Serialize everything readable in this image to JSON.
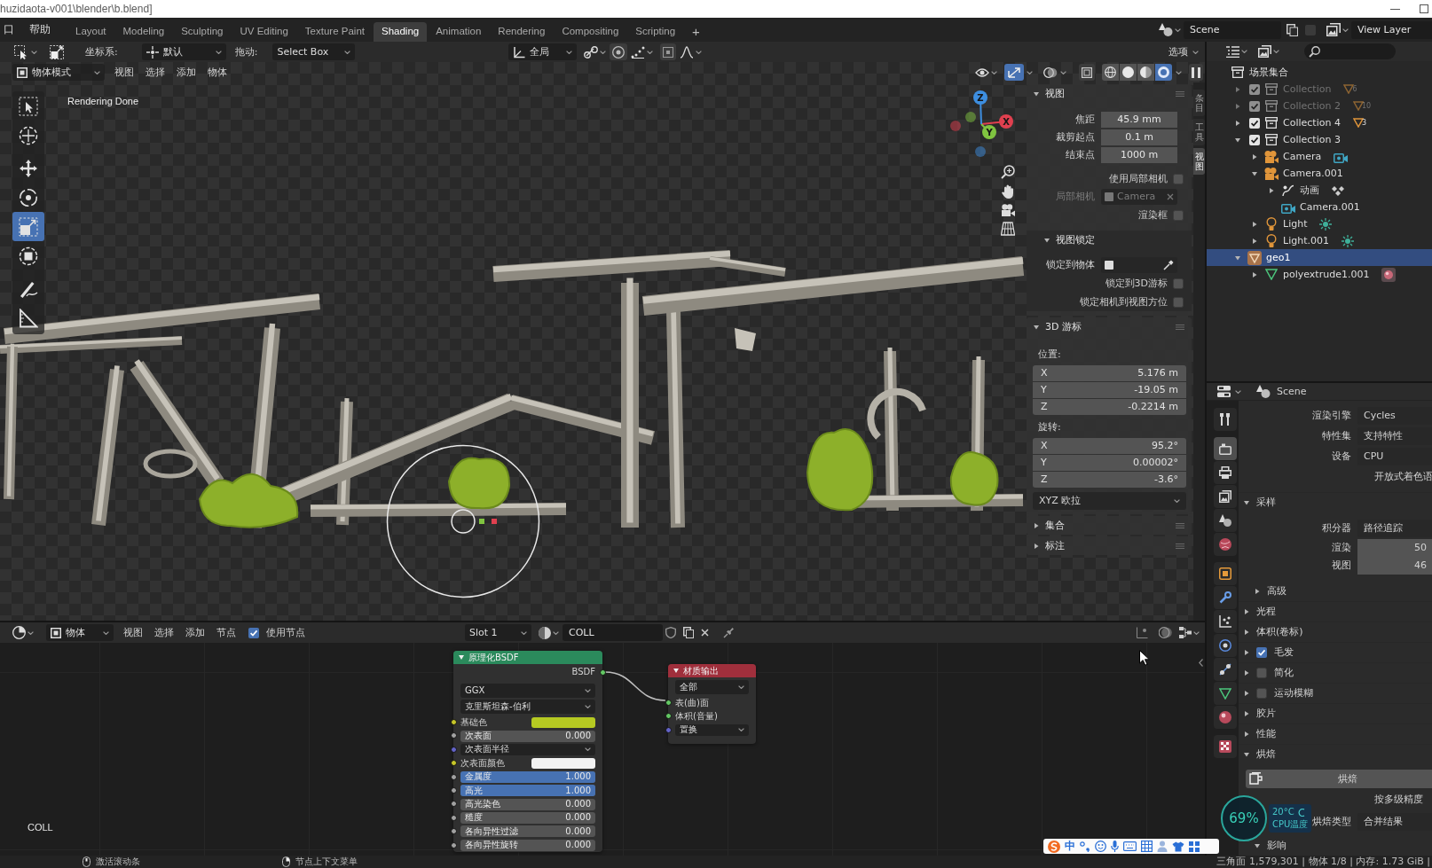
{
  "title_bar": {
    "title": "huzidaota-v001\\blender\\b.blend]"
  },
  "top_bar": {
    "menus": [
      "口",
      "帮助"
    ],
    "workspaces": [
      {
        "label": "Layout",
        "selected": false
      },
      {
        "label": "Modeling",
        "selected": false
      },
      {
        "label": "Sculpting",
        "selected": false
      },
      {
        "label": "UV Editing",
        "selected": false
      },
      {
        "label": "Texture Paint",
        "selected": false
      },
      {
        "label": "Shading",
        "selected": true
      },
      {
        "label": "Animation",
        "selected": false
      },
      {
        "label": "Rendering",
        "selected": false
      },
      {
        "label": "Compositing",
        "selected": false
      },
      {
        "label": "Scripting",
        "selected": false
      }
    ],
    "add_workspace": "+",
    "scene": "Scene",
    "view_layer": "View Layer"
  },
  "viewport": {
    "tool_settings": {
      "orientation_label": "坐标系:",
      "orientation": "默认",
      "drag_label": "拖动:",
      "drag": "Select Box",
      "transform_orientation": "全局",
      "options": "选项"
    },
    "header": {
      "mode": "物体模式",
      "menus": [
        "视图",
        "选择",
        "添加",
        "物体"
      ],
      "gizmos": true,
      "shading": [
        {
          "kind": "wireframe",
          "selected": false
        },
        {
          "kind": "solid",
          "selected": false
        },
        {
          "kind": "material",
          "selected": false
        },
        {
          "kind": "rendered",
          "selected": true
        }
      ]
    },
    "status": "Rendering Done",
    "tools": [
      {
        "kind": "select_box",
        "selected": false
      },
      {
        "kind": "cursor",
        "selected": false
      },
      {
        "kind": "move",
        "selected": false
      },
      {
        "kind": "rotate",
        "selected": false
      },
      {
        "kind": "scale",
        "selected": true
      },
      {
        "kind": "transform",
        "selected": false
      },
      {
        "kind": "annotate",
        "selected": false
      },
      {
        "kind": "measure",
        "selected": false
      }
    ],
    "gizmo_axes": [
      {
        "label": "X",
        "color": "#e0404f"
      },
      {
        "label": "Y",
        "color": "#80c440"
      },
      {
        "label": "Z",
        "color": "#3d8ee0"
      }
    ],
    "sidebar": {
      "panels": [
        {
          "title": "视图",
          "expanded": true,
          "rows": [
            {
              "kind": "number",
              "label": "焦距",
              "value": "45.9 mm"
            },
            {
              "kind": "number",
              "label": "裁剪起点",
              "value": "0.1 m"
            },
            {
              "kind": "number",
              "label": "结束点",
              "value": "1000 m"
            },
            {
              "kind": "checkbox",
              "label": "使用局部相机",
              "checked": false
            },
            {
              "kind": "object",
              "label": "局部相机",
              "value": "Camera",
              "disabled": true
            },
            {
              "kind": "checkbox",
              "label": "渲染框",
              "checked": false
            },
            {
              "kind": "subpanel",
              "title": "视图锁定",
              "expanded": true,
              "rows": [
                {
                  "kind": "picker",
                  "label": "锁定到物体"
                },
                {
                  "kind": "checkbox",
                  "label": "锁定到3D游标",
                  "checked": false
                },
                {
                  "kind": "checkbox",
                  "label": "锁定相机到视图方位",
                  "checked": false
                }
              ]
            }
          ]
        },
        {
          "title": "3D 游标",
          "expanded": true,
          "rows": [
            {
              "kind": "caption",
              "label": "位置:"
            },
            {
              "kind": "vector",
              "items": [
                {
                  "axis": "X",
                  "value": "5.176 m"
                },
                {
                  "axis": "Y",
                  "value": "-19.05 m"
                },
                {
                  "axis": "Z",
                  "value": "-0.2214 m"
                }
              ]
            },
            {
              "kind": "caption",
              "label": "旋转:"
            },
            {
              "kind": "vector",
              "items": [
                {
                  "axis": "X",
                  "value": "95.2°"
                },
                {
                  "axis": "Y",
                  "value": "0.00002°"
                },
                {
                  "axis": "Z",
                  "value": "-3.6°"
                }
              ]
            },
            {
              "kind": "dropdown",
              "value": "XYZ 欧拉"
            }
          ]
        },
        {
          "title": "集合",
          "expanded": false
        },
        {
          "title": "标注",
          "expanded": false
        }
      ]
    },
    "sidebar_tabs": [
      {
        "label": "条目",
        "selected": false
      },
      {
        "label": "工具",
        "selected": false
      },
      {
        "label": "视图",
        "selected": true
      }
    ]
  },
  "node_editor": {
    "header": {
      "object": "物体",
      "menus": [
        "视图",
        "选择",
        "添加",
        "节点"
      ],
      "use_nodes": {
        "label": "使用节点",
        "checked": true
      },
      "slot": "Slot 1",
      "material": "COLL"
    },
    "material_label": "COLL",
    "nodes": [
      {
        "kind": "principled",
        "title": "原理化BSDF",
        "output": "BSDF",
        "dropdowns": [
          "GGX",
          "克里斯坦森-伯利"
        ],
        "inputs": [
          {
            "kind": "color",
            "label": "基础色",
            "color": "#b6ca22"
          },
          {
            "kind": "value",
            "label": "次表面",
            "value": "0.000",
            "level": 0
          },
          {
            "kind": "vector",
            "label": "次表面半径"
          },
          {
            "kind": "color",
            "label": "次表面颜色",
            "color": "#f2f2f2"
          },
          {
            "kind": "value",
            "label": "金属度",
            "value": "1.000",
            "level": 1
          },
          {
            "kind": "value",
            "label": "高光",
            "value": "1.000",
            "level": 1
          },
          {
            "kind": "value",
            "label": "高光染色",
            "value": "0.000",
            "level": 0
          },
          {
            "kind": "value",
            "label": "糙度",
            "value": "0.000",
            "level": 0
          },
          {
            "kind": "value",
            "label": "各向异性过滤",
            "value": "0.000",
            "level": 0
          },
          {
            "kind": "value",
            "label": "各向异性旋转",
            "value": "0.000",
            "level": 0
          }
        ]
      },
      {
        "kind": "output",
        "title": "材质输出",
        "target": "全部",
        "inputs": [
          {
            "kind": "shader",
            "label": "表(曲)面"
          },
          {
            "kind": "shader",
            "label": "体积(音量)"
          },
          {
            "kind": "vector",
            "label": "置换"
          }
        ]
      }
    ]
  },
  "outliner": {
    "root": {
      "label": "场景集合",
      "selected": false,
      "children": [
        {
          "kind": "collection",
          "label": "Collection",
          "checked": true,
          "dimmed": true,
          "expanded": false,
          "selected": false,
          "count": "6"
        },
        {
          "kind": "collection",
          "label": "Collection 2",
          "checked": true,
          "dimmed": true,
          "expanded": false,
          "selected": false,
          "count": "10"
        },
        {
          "kind": "collection",
          "label": "Collection 4",
          "checked": true,
          "dimmed": false,
          "expanded": false,
          "selected": false,
          "count": "3"
        },
        {
          "kind": "collection",
          "label": "Collection 3",
          "checked": true,
          "dimmed": false,
          "expanded": true,
          "selected": false,
          "children": [
            {
              "kind": "camera",
              "label": "Camera",
              "expanded": false,
              "selected": false
            },
            {
              "kind": "camera",
              "label": "Camera.001",
              "expanded": true,
              "selected": false,
              "children": [
                {
                  "kind": "animation",
                  "label": "动画",
                  "expanded": false,
                  "selected": false
                },
                {
                  "kind": "camera_data",
                  "label": "Camera.001",
                  "selected": false
                }
              ]
            },
            {
              "kind": "light",
              "label": "Light",
              "expanded": false,
              "selected": false
            },
            {
              "kind": "light",
              "label": "Light.001",
              "expanded": false,
              "selected": false
            }
          ]
        },
        {
          "kind": "mesh_object",
          "label": "geo1",
          "expanded": true,
          "selected": true,
          "children": [
            {
              "kind": "mesh",
              "label": "polyextrude1.001",
              "expanded": false,
              "selected": false
            }
          ]
        }
      ]
    }
  },
  "properties": {
    "context": "Scene",
    "tabs": [
      {
        "kind": "tool",
        "selected": false
      },
      {
        "kind": "render",
        "selected": true
      },
      {
        "kind": "output",
        "selected": false
      },
      {
        "kind": "view_layer",
        "selected": false
      },
      {
        "kind": "scene",
        "selected": false
      },
      {
        "kind": "world",
        "selected": false
      },
      {
        "kind": "object",
        "selected": false
      },
      {
        "kind": "modifiers",
        "selected": false
      },
      {
        "kind": "particles",
        "selected": false
      },
      {
        "kind": "physics",
        "selected": false
      },
      {
        "kind": "constraints",
        "selected": false
      },
      {
        "kind": "data",
        "selected": false
      },
      {
        "kind": "material",
        "selected": false
      },
      {
        "kind": "texture",
        "selected": false
      }
    ],
    "rows": [
      {
        "kind": "dropdown",
        "label": "渲染引擎",
        "value": "Cycles"
      },
      {
        "kind": "dropdown",
        "label": "特性集",
        "value": "支持特性"
      },
      {
        "kind": "dropdown",
        "label": "设备",
        "value": "CPU"
      },
      {
        "kind": "text",
        "label": "开放式着色语"
      }
    ],
    "panels": [
      {
        "title": "采样",
        "expanded": true,
        "rows": [
          {
            "kind": "dropdown",
            "label": "积分器",
            "value": "路径追踪"
          },
          {
            "kind": "number",
            "label": "渲染",
            "value": "50"
          },
          {
            "kind": "number",
            "label": "视图",
            "value": "46"
          },
          {
            "kind": "subpanel",
            "title": "高级",
            "expanded": false
          }
        ]
      },
      {
        "title": "光程",
        "expanded": false
      },
      {
        "title": "体积(卷标)",
        "expanded": false
      },
      {
        "title": "毛发",
        "expanded": false,
        "checked": true
      },
      {
        "title": "简化",
        "expanded": false,
        "checked": false
      },
      {
        "title": "运动模糊",
        "expanded": false,
        "checked": false
      },
      {
        "title": "胶片",
        "expanded": false
      },
      {
        "title": "性能",
        "expanded": false
      },
      {
        "title": "烘焙",
        "expanded": true,
        "rows": [
          {
            "kind": "button",
            "label": "烘焙"
          },
          {
            "kind": "text",
            "label": "按多级精度"
          },
          {
            "kind": "dropdown",
            "label": "烘焙类型",
            "value": "合并结果"
          },
          {
            "kind": "subpanel",
            "title": "影响",
            "expanded": true
          }
        ]
      }
    ]
  },
  "status_bar": {
    "hints": [
      {
        "kind": "middle",
        "label": "激活滚动条"
      },
      {
        "kind": "right",
        "label": "节点上下文菜单"
      }
    ],
    "stats": "三角面 1,579,301 | 物体 1/8 | 内存: 1.73 GiB |"
  },
  "overlays": {
    "cpu_monitor": {
      "usage": "69%",
      "temperature": "20°C",
      "label": "CPU温度"
    },
    "input_method": {
      "mode": "中"
    }
  }
}
